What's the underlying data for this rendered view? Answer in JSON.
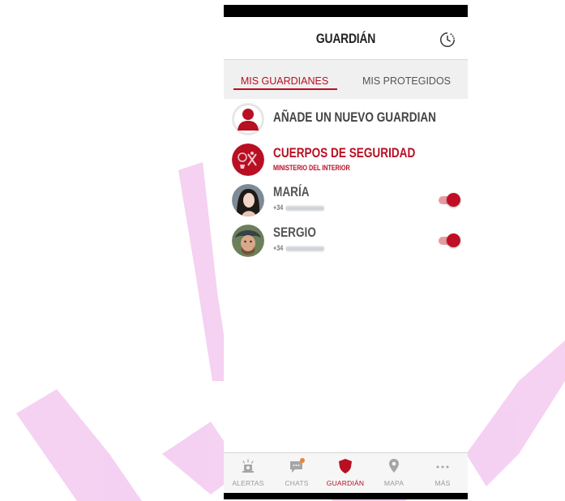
{
  "colors": {
    "accent": "#b80f22",
    "watermark": "#f3c9f0"
  },
  "header": {
    "title": "GUARDIÁN",
    "history_icon": "clock-history-icon"
  },
  "tabs": [
    {
      "label": "MIS GUARDIANES",
      "active": true
    },
    {
      "label": "MIS PROTEGIDOS",
      "active": false
    }
  ],
  "list": {
    "add_label": "AÑADE UN NUEVO GUARDIAN",
    "security": {
      "title": "CUERPOS DE SEGURIDAD",
      "subtitle": "MINISTERIO DEL INTERIOR"
    },
    "contacts": [
      {
        "name": "MARÍA",
        "phone_prefix": "+34",
        "enabled": true
      },
      {
        "name": "SERGIO",
        "phone_prefix": "+34",
        "enabled": true
      }
    ]
  },
  "bottom_nav": [
    {
      "label": "ALERTAS",
      "icon": "siren-icon",
      "active": false
    },
    {
      "label": "CHATS",
      "icon": "chat-icon",
      "active": false,
      "badge": true
    },
    {
      "label": "GUARDIÁN",
      "icon": "shield-icon",
      "active": true
    },
    {
      "label": "MAPA",
      "icon": "map-pin-icon",
      "active": false
    },
    {
      "label": "MÁS",
      "icon": "more-icon",
      "active": false
    }
  ]
}
